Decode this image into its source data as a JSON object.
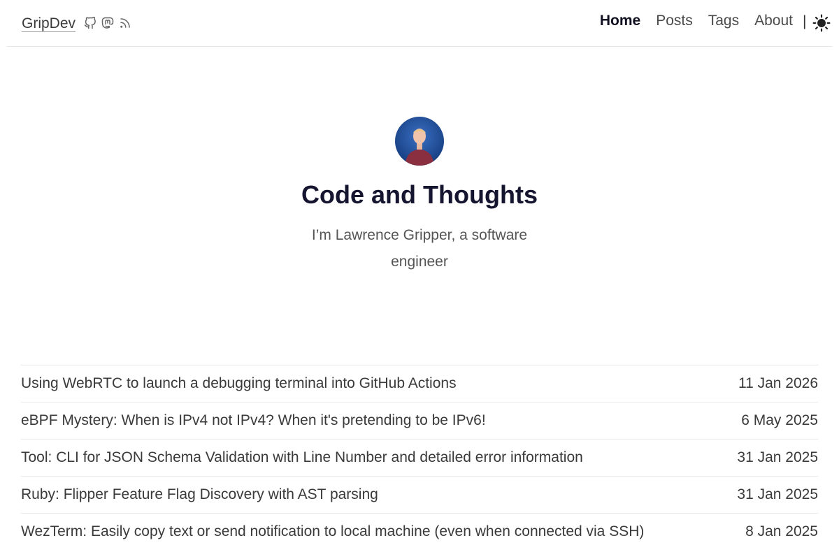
{
  "header": {
    "brand": "GripDev",
    "social_icons": [
      "github-icon",
      "mastodon-icon",
      "rss-icon"
    ],
    "nav": [
      {
        "label": "Home",
        "active": true
      },
      {
        "label": "Posts",
        "active": false
      },
      {
        "label": "Tags",
        "active": false
      },
      {
        "label": "About",
        "active": false
      }
    ],
    "separator": "|",
    "theme_icon": "sun-icon"
  },
  "hero": {
    "title": "Code and Thoughts",
    "subtitle": "I’m Lawrence Gripper, a software engineer"
  },
  "posts": [
    {
      "title": "Using WebRTC to launch a debugging terminal into GitHub Actions",
      "date": "11 Jan 2026"
    },
    {
      "title": "eBPF Mystery: When is IPv4 not IPv4? When it's pretending to be IPv6!",
      "date": "6 May 2025"
    },
    {
      "title": "Tool: CLI for JSON Schema Validation with Line Number and detailed error information",
      "date": "31 Jan 2025"
    },
    {
      "title": "Ruby: Flipper Feature Flag Discovery with AST parsing",
      "date": "31 Jan 2025"
    },
    {
      "title": "WezTerm: Easily copy text or send notification to local machine (even when connected via SSH)",
      "date": "8 Jan 2025"
    }
  ],
  "colors": {
    "title": "#151530",
    "avatar_bg": "#1f4f9a",
    "shirt": "#8a2f3f"
  }
}
